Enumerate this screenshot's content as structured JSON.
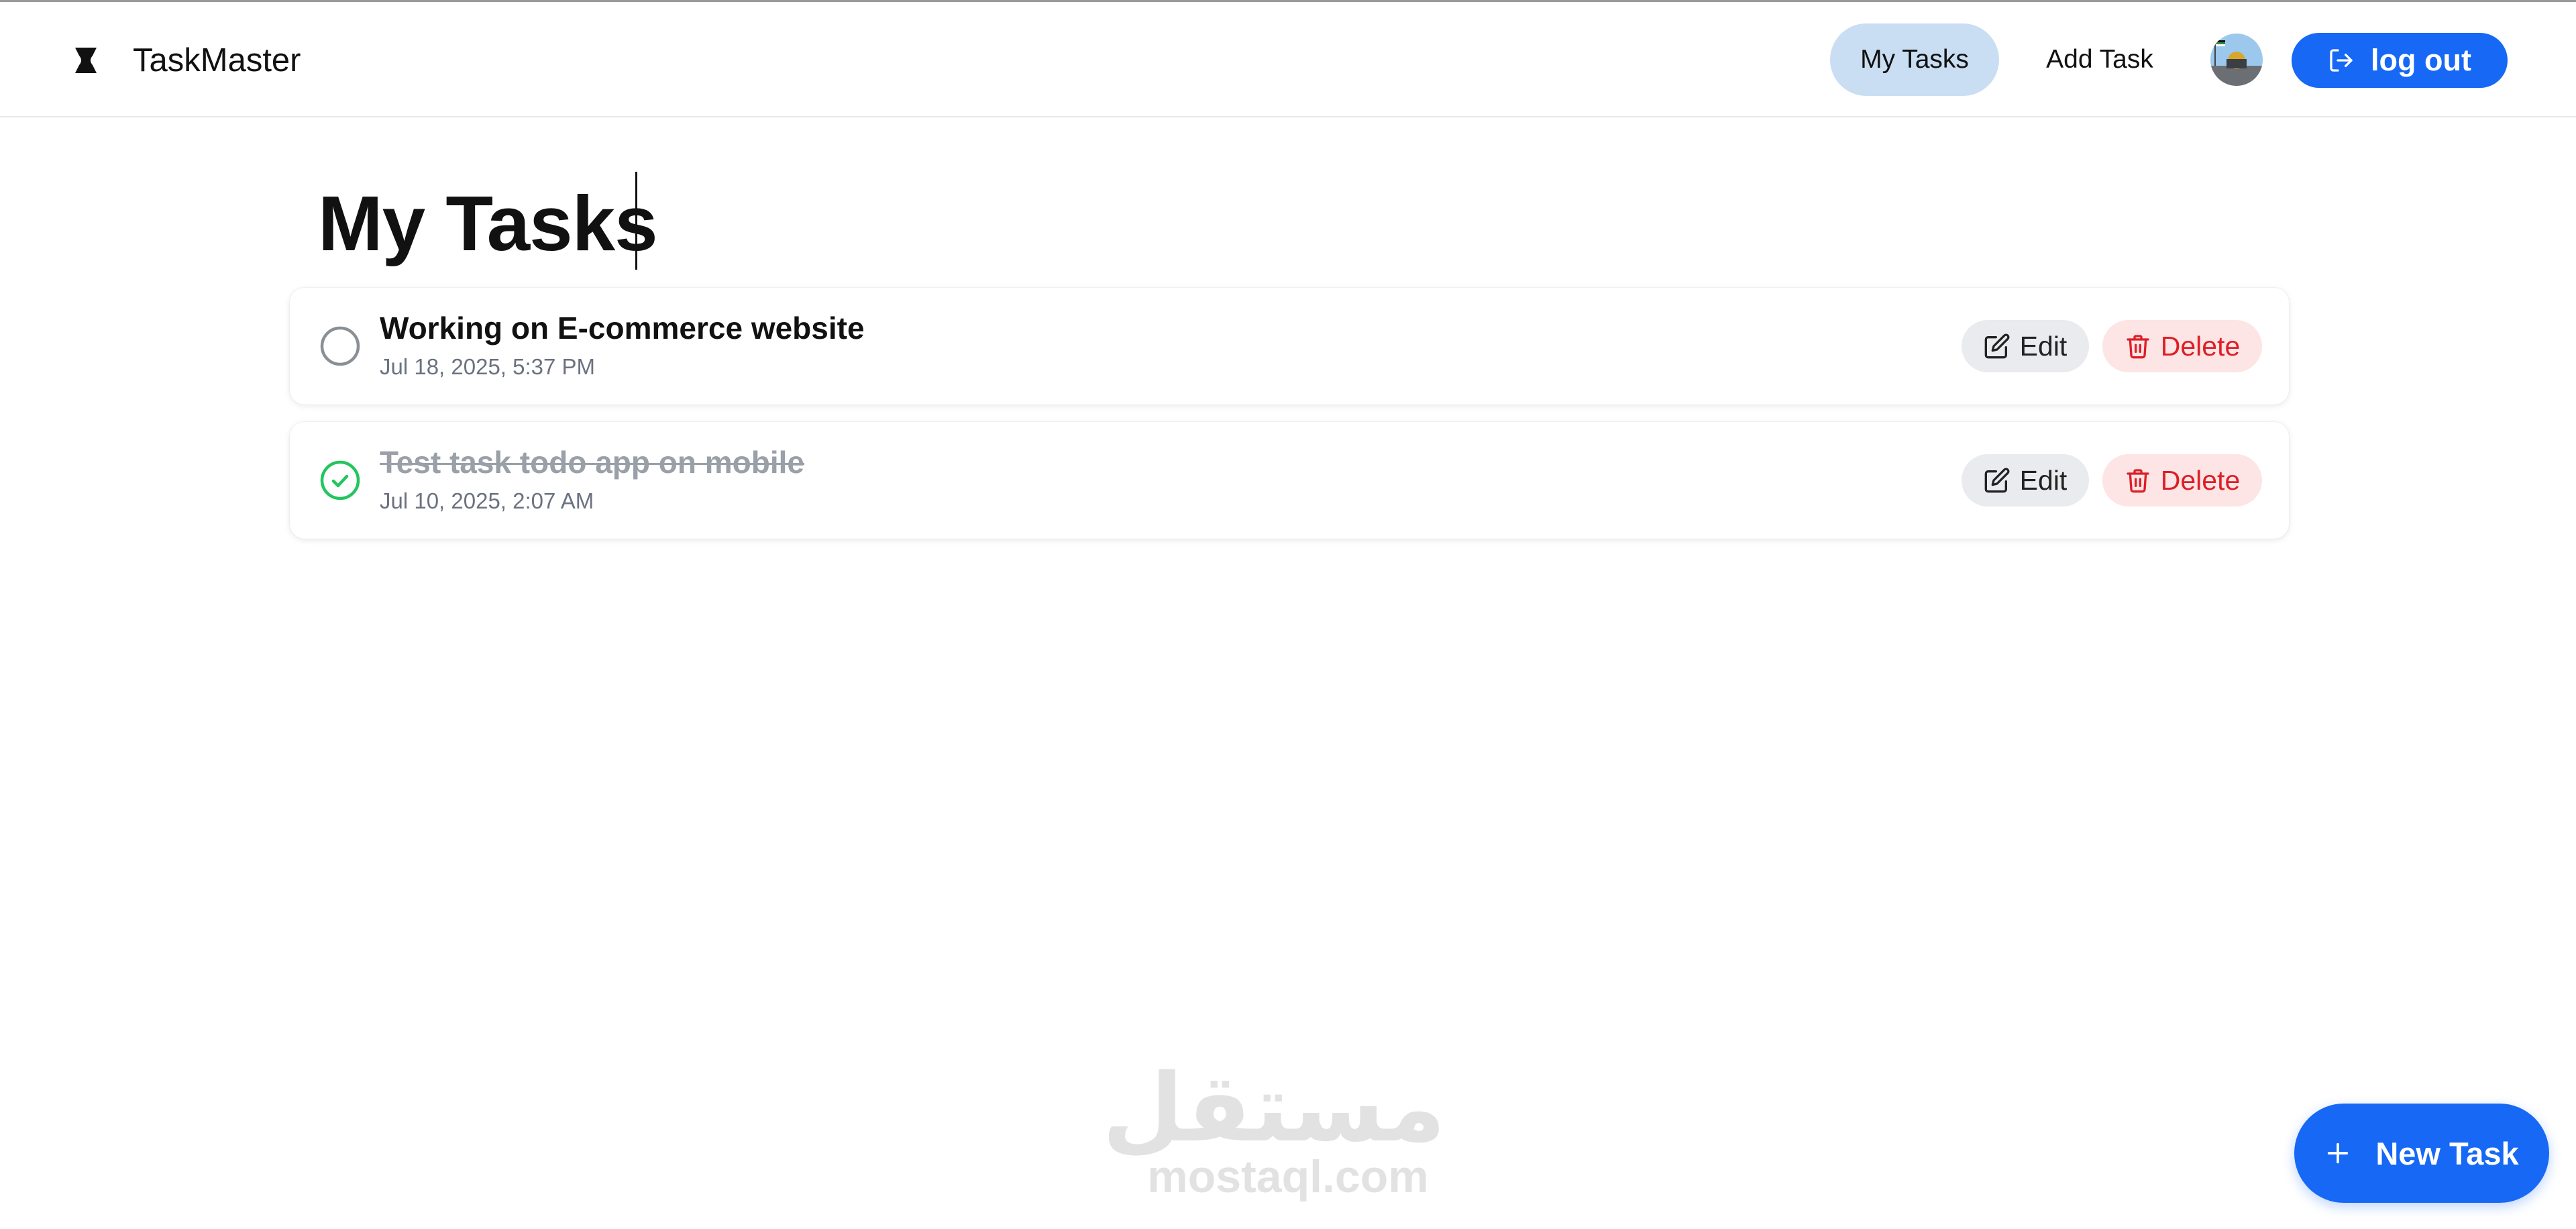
{
  "app": {
    "name": "TaskMaster",
    "logo_icon": "hourglass-logo-icon"
  },
  "nav": {
    "my_tasks_label": "My Tasks",
    "add_task_label": "Add Task",
    "avatar_icon": "user-avatar",
    "logout_label": "log out",
    "logout_icon": "logout-icon"
  },
  "page": {
    "title": "My Tasks"
  },
  "tasks": [
    {
      "title": "Working on E-commerce website",
      "date": "Jul 18, 2025, 5:37 PM",
      "completed": false,
      "edit_label": "Edit",
      "delete_label": "Delete"
    },
    {
      "title": "Test task todo app on mobile",
      "date": "Jul 10, 2025, 2:07 AM",
      "completed": true,
      "edit_label": "Edit",
      "delete_label": "Delete"
    }
  ],
  "fab": {
    "label": "New Task",
    "icon": "plus-icon"
  },
  "watermark": {
    "arabic": "مستقل",
    "latin": "mostaql.com"
  },
  "colors": {
    "accent": "#1668f5",
    "nav_active_bg": "#c9def2",
    "delete_text": "#dc1f26",
    "delete_bg": "#fde4e5",
    "edit_bg": "#e9ebee",
    "done_check": "#22c55e",
    "muted_text": "#6b7280"
  }
}
